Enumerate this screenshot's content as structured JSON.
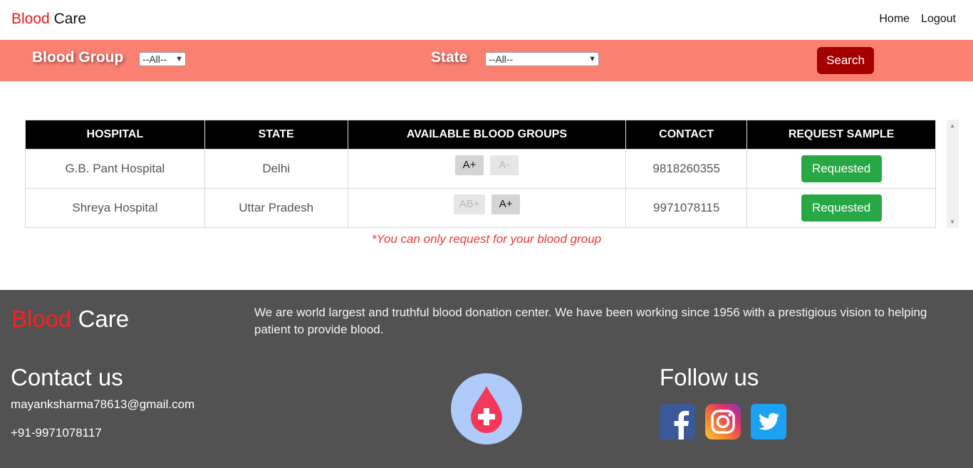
{
  "navbar": {
    "brand_part1": "Blood",
    "brand_part2": "Care",
    "links": [
      "Home",
      "Logout"
    ]
  },
  "filters": {
    "blood_group_label": "Blood Group",
    "blood_group_value": "--All--",
    "state_label": "State",
    "state_value": "--All--",
    "search_label": "Search"
  },
  "table": {
    "headers": [
      "HOSPITAL",
      "STATE",
      "AVAILABLE BLOOD GROUPS",
      "CONTACT",
      "REQUEST SAMPLE"
    ],
    "rows": [
      {
        "hospital": "G.B. Pant Hospital",
        "state": "Delhi",
        "groups": [
          {
            "label": "A+",
            "enabled": true
          },
          {
            "label": "A-",
            "enabled": false
          }
        ],
        "contact": "9818260355",
        "action": "Requested"
      },
      {
        "hospital": "Shreya Hospital",
        "state": "Uttar Pradesh",
        "groups": [
          {
            "label": "AB+",
            "enabled": false
          },
          {
            "label": "A+",
            "enabled": true
          }
        ],
        "contact": "9971078115",
        "action": "Requested"
      }
    ]
  },
  "note": "*You can only request for your blood group",
  "footer": {
    "brand_part1": "Blood",
    "brand_part2": "Care",
    "about": "We are world largest and truthful blood donation center. We have been working since 1956 with a prestigious vision to helping patient to provide blood.",
    "contact_heading": "Contact us",
    "email": "mayanksharma78613@gmail.com",
    "phone": "+91-9971078117",
    "follow_heading": "Follow us",
    "social_icons": [
      "facebook-icon",
      "instagram-icon",
      "twitter-icon"
    ]
  },
  "colors": {
    "filter_bar": "#fa8072",
    "search_button": "#a50000",
    "request_button": "#28a745",
    "footer_bg": "#525252",
    "brand_red": "#e21b1b"
  }
}
